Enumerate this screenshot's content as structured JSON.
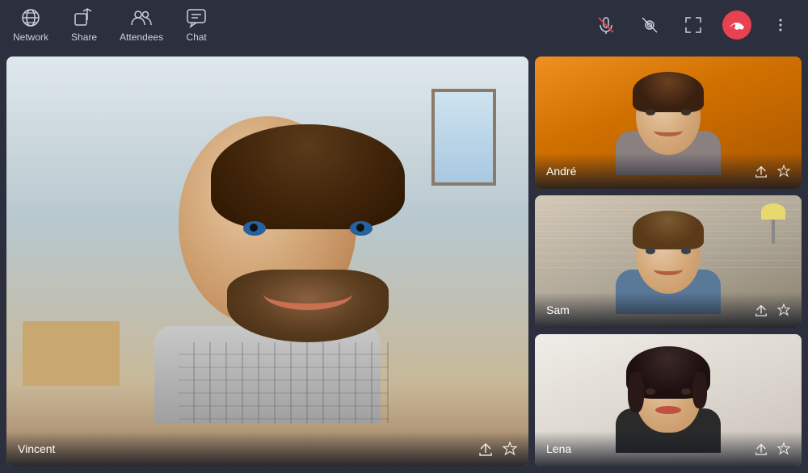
{
  "topbar": {
    "nav_items": [
      {
        "id": "network",
        "label": "Network",
        "icon": "network-icon"
      },
      {
        "id": "share",
        "label": "Share",
        "icon": "share-icon"
      },
      {
        "id": "attendees",
        "label": "Attendees",
        "icon": "attendees-icon"
      },
      {
        "id": "chat",
        "label": "Chat",
        "icon": "chat-icon"
      }
    ],
    "controls": [
      {
        "id": "mute",
        "icon": "mic-off-icon"
      },
      {
        "id": "camera",
        "icon": "camera-icon"
      },
      {
        "id": "fullscreen",
        "icon": "fullscreen-icon"
      },
      {
        "id": "end-call",
        "icon": "end-call-icon"
      },
      {
        "id": "more",
        "icon": "more-icon"
      }
    ]
  },
  "participants": [
    {
      "id": "vincent",
      "name": "Vincent",
      "is_primary": true,
      "bg_color": "#b0c0c8"
    },
    {
      "id": "andre",
      "name": "André",
      "is_primary": false,
      "bg_color": "#e07800"
    },
    {
      "id": "sam",
      "name": "Sam",
      "is_primary": false,
      "bg_color": "#b0a898"
    },
    {
      "id": "lena",
      "name": "Lena",
      "is_primary": false,
      "bg_color": "#ddd8d0"
    }
  ],
  "actions": {
    "share_label": "⇪",
    "star_label": "☆"
  },
  "colors": {
    "topbar_bg": "#2b2f3e",
    "end_call": "#e8414f",
    "text": "#cdd0da",
    "andre_bg": "#e07800"
  }
}
